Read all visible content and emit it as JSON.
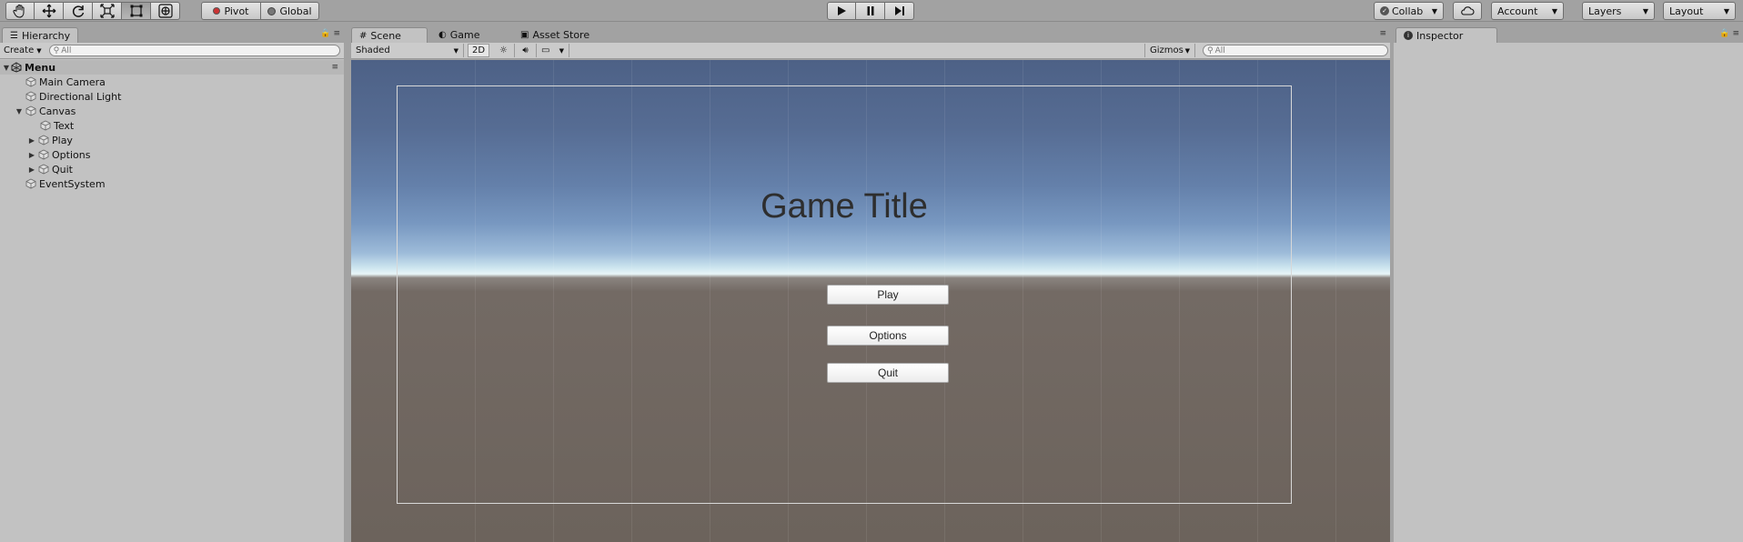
{
  "toolbar": {
    "tools": [
      "hand-tool",
      "move-tool",
      "rotate-tool",
      "scale-tool",
      "rect-tool",
      "transform-tool"
    ],
    "pivot_label": "Pivot",
    "global_label": "Global",
    "collab_label": "Collab",
    "account_label": "Account",
    "layers_label": "Layers",
    "layout_label": "Layout"
  },
  "hierarchy": {
    "tab_label": "Hierarchy",
    "create_label": "Create",
    "search_placeholder": "All",
    "scene_name": "Menu",
    "items": [
      {
        "label": "Main Camera"
      },
      {
        "label": "Directional Light"
      },
      {
        "label": "Canvas"
      },
      {
        "label": "Text"
      },
      {
        "label": "Play"
      },
      {
        "label": "Options"
      },
      {
        "label": "Quit"
      },
      {
        "label": "EventSystem"
      }
    ]
  },
  "scene": {
    "tabs": [
      {
        "label": "Scene"
      },
      {
        "label": "Game"
      },
      {
        "label": "Asset Store"
      }
    ],
    "shading_mode": "Shaded",
    "mode_2d_label": "2D",
    "gizmos_label": "Gizmos",
    "search_placeholder": "All",
    "game_title": "Game Title",
    "buttons": [
      {
        "label": "Play"
      },
      {
        "label": "Options"
      },
      {
        "label": "Quit"
      }
    ]
  },
  "inspector": {
    "tab_label": "Inspector"
  },
  "colors": {
    "sky_top": "#4d6186",
    "horizon": "#e8f5f8",
    "ground": "#6c635c",
    "panel_bg": "#c2c2c2"
  }
}
